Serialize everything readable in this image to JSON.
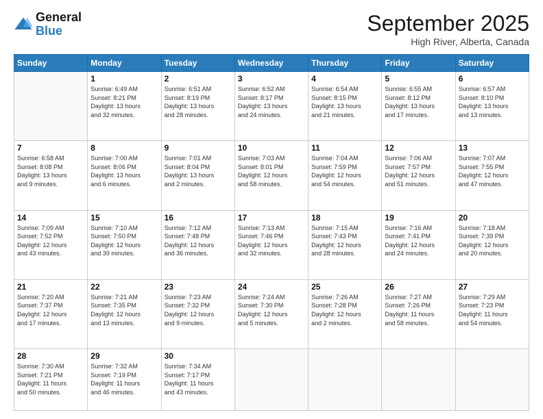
{
  "header": {
    "logo": {
      "line1": "General",
      "line2": "Blue"
    },
    "title": "September 2025",
    "location": "High River, Alberta, Canada"
  },
  "weekdays": [
    "Sunday",
    "Monday",
    "Tuesday",
    "Wednesday",
    "Thursday",
    "Friday",
    "Saturday"
  ],
  "weeks": [
    [
      null,
      {
        "num": "1",
        "info": "Sunrise: 6:49 AM\nSunset: 8:21 PM\nDaylight: 13 hours\nand 32 minutes."
      },
      {
        "num": "2",
        "info": "Sunrise: 6:51 AM\nSunset: 8:19 PM\nDaylight: 13 hours\nand 28 minutes."
      },
      {
        "num": "3",
        "info": "Sunrise: 6:52 AM\nSunset: 8:17 PM\nDaylight: 13 hours\nand 24 minutes."
      },
      {
        "num": "4",
        "info": "Sunrise: 6:54 AM\nSunset: 8:15 PM\nDaylight: 13 hours\nand 21 minutes."
      },
      {
        "num": "5",
        "info": "Sunrise: 6:55 AM\nSunset: 8:12 PM\nDaylight: 13 hours\nand 17 minutes."
      },
      {
        "num": "6",
        "info": "Sunrise: 6:57 AM\nSunset: 8:10 PM\nDaylight: 13 hours\nand 13 minutes."
      }
    ],
    [
      {
        "num": "7",
        "info": "Sunrise: 6:58 AM\nSunset: 8:08 PM\nDaylight: 13 hours\nand 9 minutes."
      },
      {
        "num": "8",
        "info": "Sunrise: 7:00 AM\nSunset: 8:06 PM\nDaylight: 13 hours\nand 6 minutes."
      },
      {
        "num": "9",
        "info": "Sunrise: 7:01 AM\nSunset: 8:04 PM\nDaylight: 13 hours\nand 2 minutes."
      },
      {
        "num": "10",
        "info": "Sunrise: 7:03 AM\nSunset: 8:01 PM\nDaylight: 12 hours\nand 58 minutes."
      },
      {
        "num": "11",
        "info": "Sunrise: 7:04 AM\nSunset: 7:59 PM\nDaylight: 12 hours\nand 54 minutes."
      },
      {
        "num": "12",
        "info": "Sunrise: 7:06 AM\nSunset: 7:57 PM\nDaylight: 12 hours\nand 51 minutes."
      },
      {
        "num": "13",
        "info": "Sunrise: 7:07 AM\nSunset: 7:55 PM\nDaylight: 12 hours\nand 47 minutes."
      }
    ],
    [
      {
        "num": "14",
        "info": "Sunrise: 7:09 AM\nSunset: 7:52 PM\nDaylight: 12 hours\nand 43 minutes."
      },
      {
        "num": "15",
        "info": "Sunrise: 7:10 AM\nSunset: 7:50 PM\nDaylight: 12 hours\nand 39 minutes."
      },
      {
        "num": "16",
        "info": "Sunrise: 7:12 AM\nSunset: 7:48 PM\nDaylight: 12 hours\nand 36 minutes."
      },
      {
        "num": "17",
        "info": "Sunrise: 7:13 AM\nSunset: 7:46 PM\nDaylight: 12 hours\nand 32 minutes."
      },
      {
        "num": "18",
        "info": "Sunrise: 7:15 AM\nSunset: 7:43 PM\nDaylight: 12 hours\nand 28 minutes."
      },
      {
        "num": "19",
        "info": "Sunrise: 7:16 AM\nSunset: 7:41 PM\nDaylight: 12 hours\nand 24 minutes."
      },
      {
        "num": "20",
        "info": "Sunrise: 7:18 AM\nSunset: 7:39 PM\nDaylight: 12 hours\nand 20 minutes."
      }
    ],
    [
      {
        "num": "21",
        "info": "Sunrise: 7:20 AM\nSunset: 7:37 PM\nDaylight: 12 hours\nand 17 minutes."
      },
      {
        "num": "22",
        "info": "Sunrise: 7:21 AM\nSunset: 7:35 PM\nDaylight: 12 hours\nand 13 minutes."
      },
      {
        "num": "23",
        "info": "Sunrise: 7:23 AM\nSunset: 7:32 PM\nDaylight: 12 hours\nand 9 minutes."
      },
      {
        "num": "24",
        "info": "Sunrise: 7:24 AM\nSunset: 7:30 PM\nDaylight: 12 hours\nand 5 minutes."
      },
      {
        "num": "25",
        "info": "Sunrise: 7:26 AM\nSunset: 7:28 PM\nDaylight: 12 hours\nand 2 minutes."
      },
      {
        "num": "26",
        "info": "Sunrise: 7:27 AM\nSunset: 7:26 PM\nDaylight: 11 hours\nand 58 minutes."
      },
      {
        "num": "27",
        "info": "Sunrise: 7:29 AM\nSunset: 7:23 PM\nDaylight: 11 hours\nand 54 minutes."
      }
    ],
    [
      {
        "num": "28",
        "info": "Sunrise: 7:30 AM\nSunset: 7:21 PM\nDaylight: 11 hours\nand 50 minutes."
      },
      {
        "num": "29",
        "info": "Sunrise: 7:32 AM\nSunset: 7:19 PM\nDaylight: 11 hours\nand 46 minutes."
      },
      {
        "num": "30",
        "info": "Sunrise: 7:34 AM\nSunset: 7:17 PM\nDaylight: 11 hours\nand 43 minutes."
      },
      null,
      null,
      null,
      null
    ]
  ]
}
